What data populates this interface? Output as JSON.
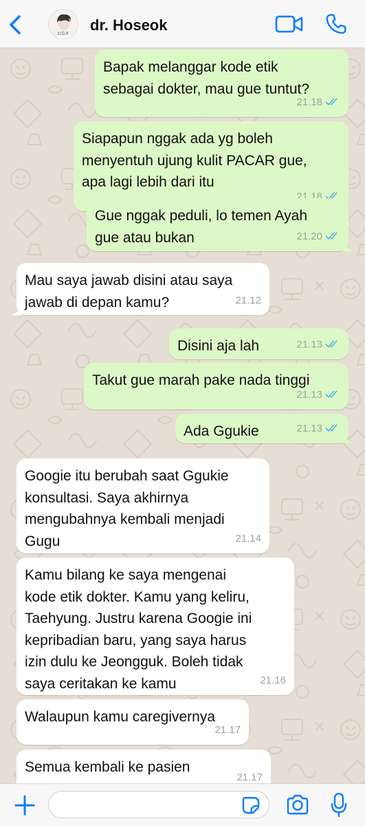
{
  "header": {
    "contact_name": "dr. Hoseok",
    "avatar_caption": "UGX"
  },
  "messages": [
    {
      "dir": "out",
      "text": "Bapak melanggar kode etik\nsebagai dokter, mau gue tuntut?",
      "time": "21.18",
      "read": true
    },
    {
      "dir": "out",
      "text": "Siapapun nggak ada yg boleh\nmenyentuh ujung kulit PACAR gue,\napa lagi lebih dari itu",
      "time": "21.18",
      "read": true
    },
    {
      "dir": "out",
      "text": "Gue nggak peduli, lo temen Ayah\ngue atau bukan",
      "time": "21.20",
      "read": true
    },
    {
      "dir": "in",
      "text": "Mau saya jawab disini atau saya\njawab di depan kamu?",
      "time": "21.12"
    },
    {
      "dir": "out",
      "text": "Disini aja lah",
      "time": "21.13",
      "read": true
    },
    {
      "dir": "out",
      "text": "Takut gue marah pake nada tinggi",
      "time": "21.13",
      "read": true
    },
    {
      "dir": "out",
      "text": "Ada Ggukie",
      "time": "21.13",
      "read": true
    },
    {
      "dir": "in",
      "text": "Googie itu berubah saat Ggukie\nkonsultasi. Saya akhirnya\nmengubahnya kembali menjadi\nGugu",
      "time": "21.14"
    },
    {
      "dir": "in",
      "text": "Kamu bilang ke saya mengenai\nkode etik dokter. Kamu yang keliru,\nTaehyung. Justru karena Googie ini\nkepribadian baru, yang saya harus\nizin dulu ke Jeongguk. Boleh tidak\nsaya ceritakan ke kamu",
      "time": "21.16"
    },
    {
      "dir": "in",
      "text": "Walaupun kamu caregivernya",
      "time": "21.17"
    },
    {
      "dir": "in",
      "text": "Semua kembali ke pasien",
      "time": "21.17"
    }
  ],
  "composer": {
    "value": "",
    "placeholder": ""
  },
  "colors": {
    "accent": "#0a7cff",
    "outgoing_bubble": "#dcf8c6",
    "incoming_bubble": "#ffffff",
    "read_ticks": "#4fb3e8",
    "chat_background": "#e6ddd4"
  },
  "icons": {
    "back": "chevron-left-icon",
    "video": "video-camera-icon",
    "call": "phone-icon",
    "attach": "plus-icon",
    "sticker": "sticker-icon",
    "camera": "camera-icon",
    "mic": "microphone-icon",
    "read_receipt": "double-check-icon"
  }
}
